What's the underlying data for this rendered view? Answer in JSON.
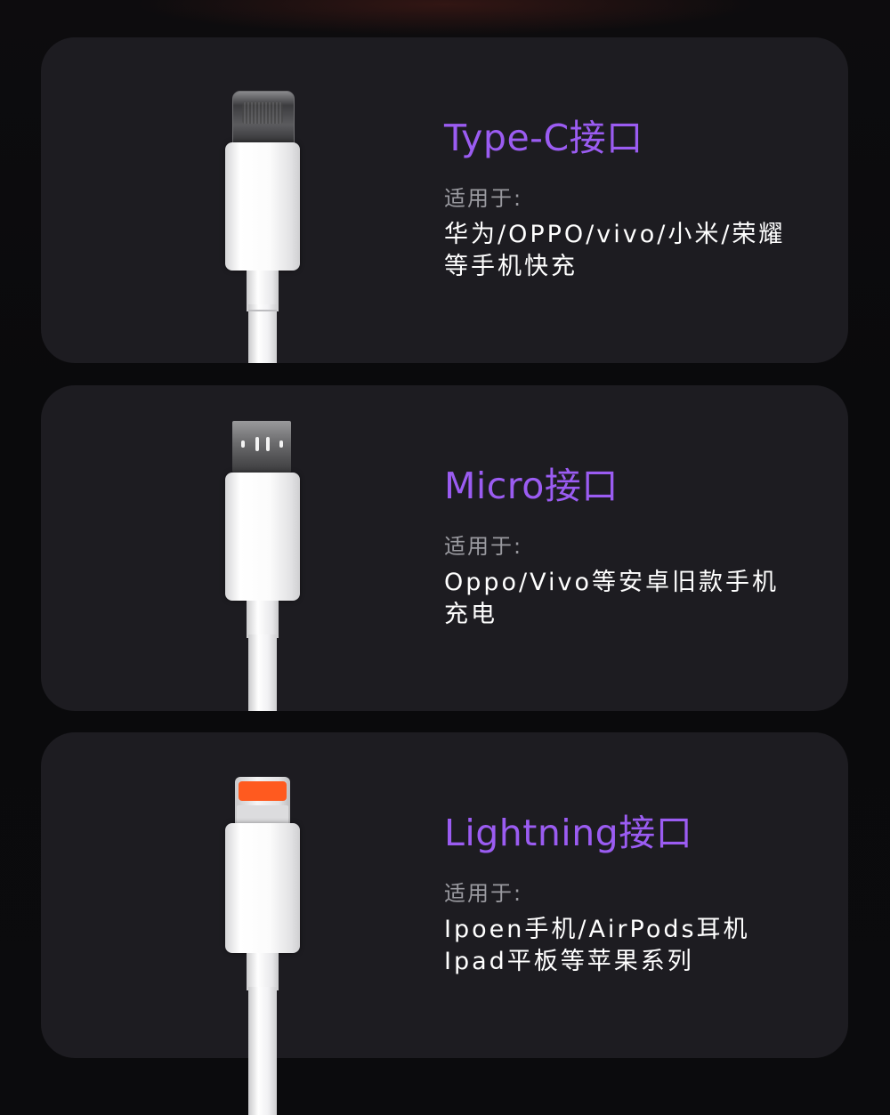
{
  "cards": [
    {
      "title": "Type-C接口",
      "subtitle": "适用于:",
      "desc_line1": "华为/OPPO/vivo/小米/荣耀",
      "desc_line2": "等手机快充",
      "connector_icon": "type-c-connector-icon"
    },
    {
      "title": "Micro接口",
      "subtitle": "适用于:",
      "desc_line1": "Oppo/Vivo等安卓旧款手机",
      "desc_line2": "充电",
      "connector_icon": "micro-usb-connector-icon"
    },
    {
      "title": "Lightning接口",
      "subtitle": "适用于:",
      "desc_line1": "Ipoen手机/AirPods耳机",
      "desc_line2": "Ipad平板等苹果系列",
      "connector_icon": "lightning-connector-icon"
    }
  ],
  "colors": {
    "title_purple": "#9b5cf2",
    "card_background": "#1d1c21",
    "lightning_tip_orange": "#ff5a1f"
  }
}
